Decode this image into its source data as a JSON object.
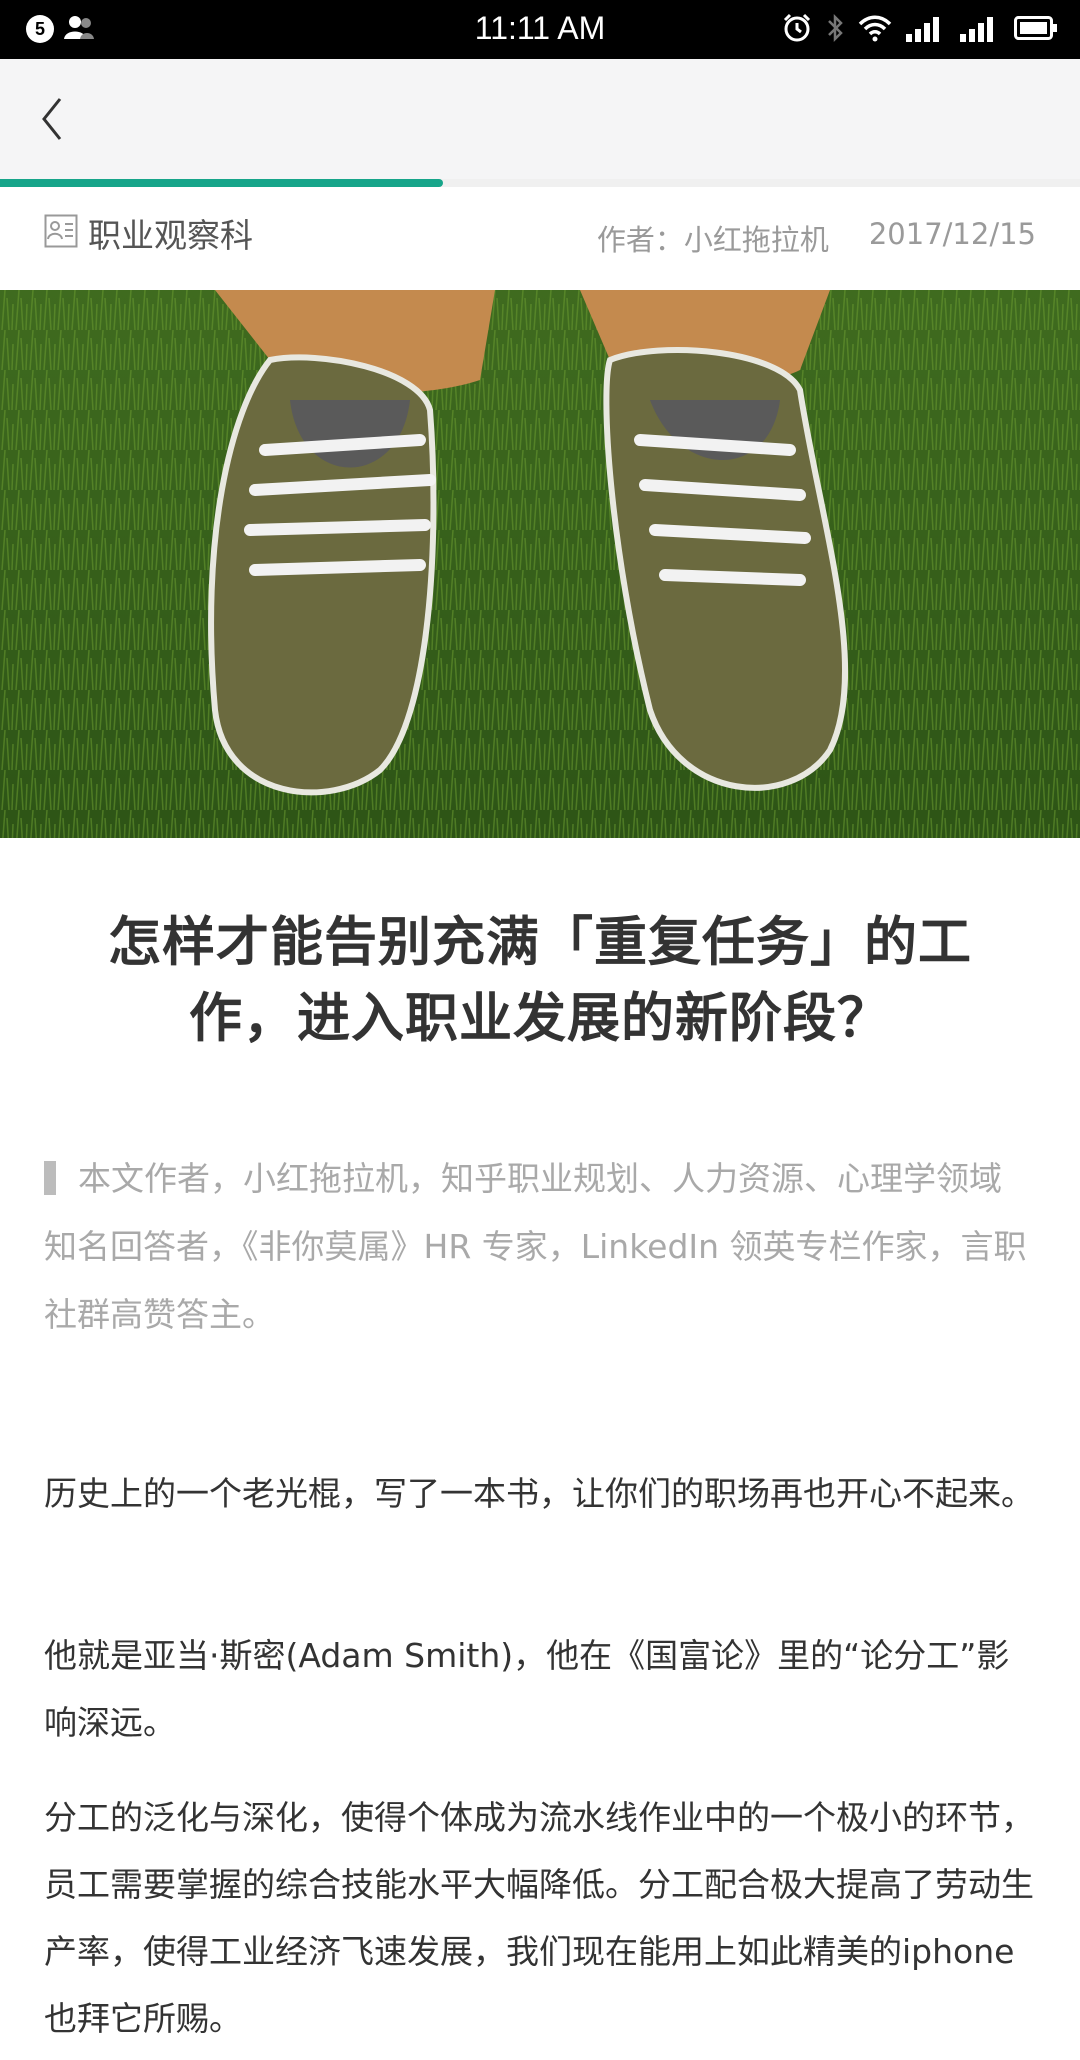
{
  "status_bar": {
    "notification_count": "5",
    "time": "11:11 AM"
  },
  "nav": {
    "reading_progress": 0.41
  },
  "meta": {
    "column": "职业观察科",
    "author": "作者：小红拖拉机",
    "date": "2017/12/15"
  },
  "article": {
    "title": "怎样才能告别充满「重复任务」的工作，进入职业发展的新阶段？",
    "intro": "本文作者，小红拖拉机，知乎职业规划、人力资源、心理学领域知名回答者，《非你莫属》HR 专家，LinkedIn 领英专栏作家，言职社群高赞答主。",
    "paragraphs": [
      "历史上的一个老光棍，写了一本书，让你们的职场再也开心不起来。",
      "他就是亚当·斯密(Adam Smith)，他在《国富论》里的“论分工”影响深远。",
      "分工的泛化与深化，使得个体成为流水线作业中的一个极小的环节，员工需要掌握的综合技能水平大幅降低。分工配合极大提高了劳动生产率，使得工业经济飞速发展，我们现在能用上如此精美的iphone也拜它所赐。"
    ]
  },
  "colors": {
    "accent": "#17a58a",
    "nav_bg": "#f5f5f6",
    "status_bar_bg": "#000000"
  },
  "icons": [
    "user-icon",
    "alarm-icon",
    "bluetooth-icon",
    "wifi-icon",
    "signal-icon",
    "battery-icon",
    "back-chevron-icon",
    "contact-card-icon"
  ]
}
